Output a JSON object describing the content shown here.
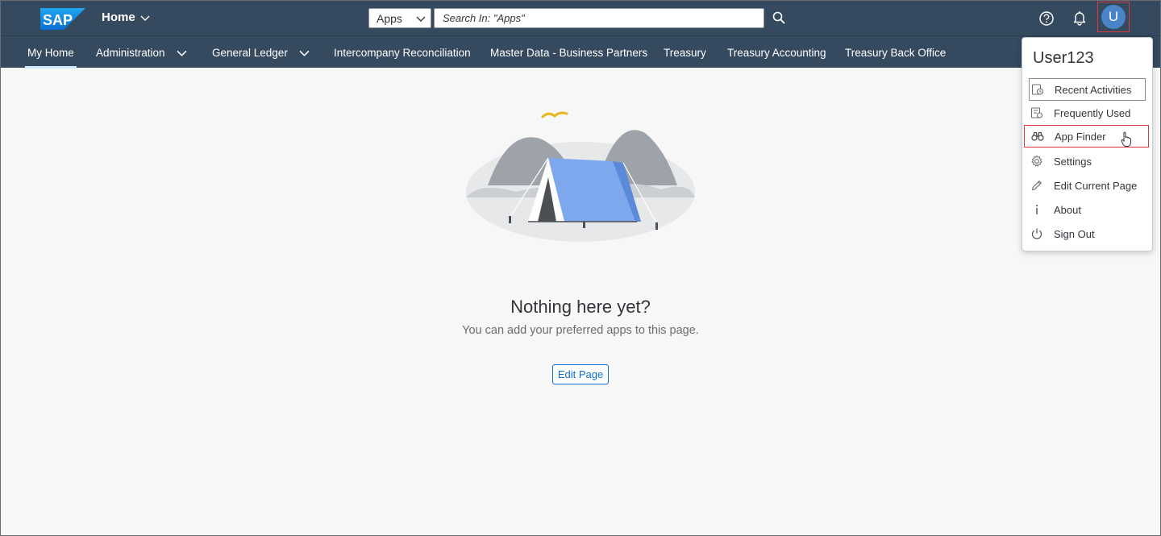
{
  "header": {
    "logo_text": "SAP",
    "home_title": "Home",
    "search_scope": "Apps",
    "search_placeholder": "Search In: \"Apps\"",
    "avatar_initial": "U"
  },
  "nav": {
    "items": [
      {
        "label": "My Home",
        "active": true
      },
      {
        "label": "Administration",
        "has_dropdown": true
      },
      {
        "label": "General Ledger",
        "has_dropdown": true
      },
      {
        "label": "Intercompany Reconciliation"
      },
      {
        "label": "Master Data - Business Partners"
      },
      {
        "label": "Treasury"
      },
      {
        "label": "Treasury Accounting"
      },
      {
        "label": "Treasury Back Office"
      }
    ]
  },
  "empty_state": {
    "title": "Nothing here yet?",
    "subtitle": "You can add your preferred apps to this page.",
    "button_label": "Edit Page"
  },
  "user_menu": {
    "user_name": "User123",
    "items": [
      {
        "label": "Recent Activities",
        "icon": "recent-activities-icon"
      },
      {
        "label": "Frequently Used",
        "icon": "frequently-used-icon"
      },
      {
        "label": "App Finder",
        "icon": "binoculars-icon"
      },
      {
        "label": "Settings",
        "icon": "gear-icon"
      },
      {
        "label": "Edit Current Page",
        "icon": "pencil-icon"
      },
      {
        "label": "About",
        "icon": "info-icon"
      },
      {
        "label": "Sign Out",
        "icon": "power-icon"
      }
    ]
  },
  "colors": {
    "shell_bg": "#354a5f",
    "accent": "#0a6ed1",
    "highlight": "#e3363b",
    "avatar": "#4a84c8"
  }
}
